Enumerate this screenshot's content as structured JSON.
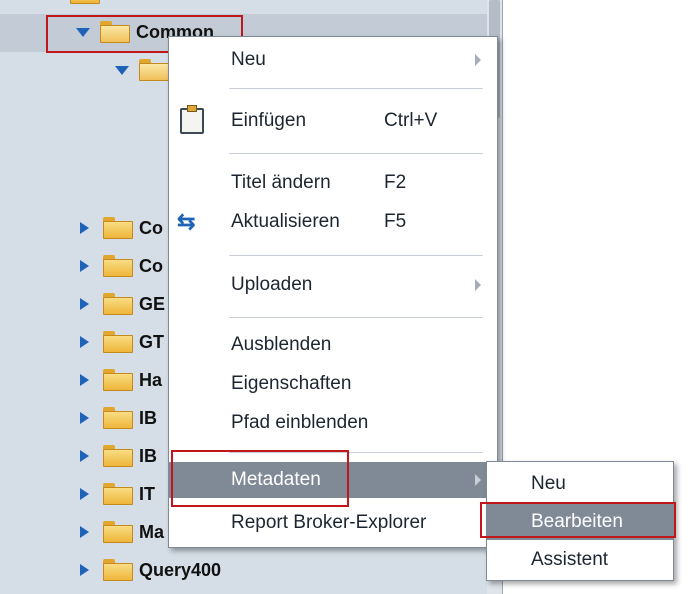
{
  "tree": {
    "nodes": [
      {
        "label": "Common",
        "expanded": true
      },
      {
        "label": "",
        "expanded": true
      },
      {
        "label": "Co",
        "expanded": false
      },
      {
        "label": "Co",
        "expanded": false
      },
      {
        "label": "GE",
        "expanded": false
      },
      {
        "label": "GT",
        "expanded": false
      },
      {
        "label": "Ha",
        "expanded": false
      },
      {
        "label": "IB",
        "expanded": false
      },
      {
        "label": "IB",
        "expanded": false
      },
      {
        "label": "IT",
        "expanded": false
      },
      {
        "label": "Ma",
        "expanded": false
      },
      {
        "label": "Query400",
        "expanded": false
      }
    ]
  },
  "context_menu": {
    "items": [
      {
        "label": "Neu",
        "shortcut": "",
        "has_submenu": true,
        "icon": ""
      },
      {
        "label": "Einfügen",
        "shortcut": "Ctrl+V",
        "has_submenu": false,
        "icon": "paste-icon"
      },
      {
        "label": "Titel ändern",
        "shortcut": "F2",
        "has_submenu": false,
        "icon": ""
      },
      {
        "label": "Aktualisieren",
        "shortcut": "F5",
        "has_submenu": false,
        "icon": "refresh-icon"
      },
      {
        "label": "Uploaden",
        "shortcut": "",
        "has_submenu": true,
        "icon": ""
      },
      {
        "label": "Ausblenden",
        "shortcut": "",
        "has_submenu": false,
        "icon": ""
      },
      {
        "label": "Eigenschaften",
        "shortcut": "",
        "has_submenu": false,
        "icon": ""
      },
      {
        "label": "Pfad einblenden",
        "shortcut": "",
        "has_submenu": false,
        "icon": ""
      },
      {
        "label": "Metadaten",
        "shortcut": "",
        "has_submenu": true,
        "icon": "",
        "active": true
      },
      {
        "label": "Report Broker-Explorer",
        "shortcut": "",
        "has_submenu": false,
        "icon": ""
      }
    ]
  },
  "submenu": {
    "items": [
      {
        "label": "Neu"
      },
      {
        "label": "Bearbeiten",
        "active": true
      },
      {
        "label": "Assistent"
      }
    ]
  },
  "colors": {
    "highlight_box": "#c0171b",
    "menu_active_bg": "#7f8a96",
    "tree_bg": "#d5dde6",
    "expander": "#1e63b8"
  }
}
